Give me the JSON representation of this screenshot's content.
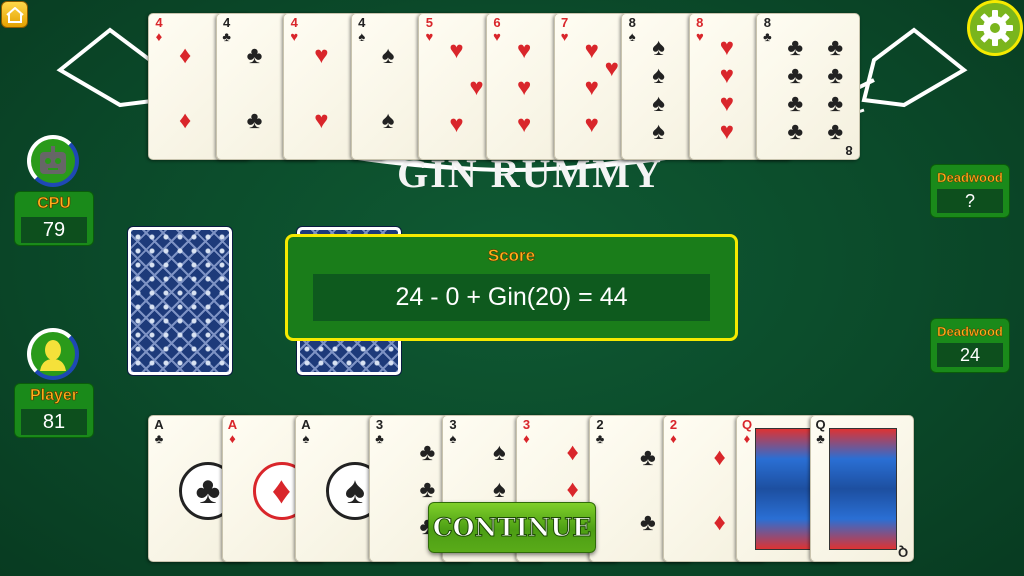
{
  "banner_text": "GIN RUMMY",
  "cpu": {
    "label": "CPU",
    "score": "79",
    "deadwood_label": "Deadwood",
    "deadwood": "?"
  },
  "player": {
    "label": "Player",
    "score": "81",
    "deadwood_label": "Deadwood",
    "deadwood": "24"
  },
  "score_dialog": {
    "title": "Score",
    "equation": "24 - 0 + Gin(20) = 44"
  },
  "continue_label": "CONTINUE",
  "icons": {
    "home": "home-icon",
    "settings": "gear-icon",
    "cpu_avatar": "robot-icon",
    "player_avatar": "person-icon"
  },
  "colors": {
    "felt": "#0b4a2a",
    "panel": "#1a8a1a",
    "label": "#ffb21a",
    "dialog_border": "#f5ea00",
    "red_suit": "#d9262b"
  },
  "cpu_hand": [
    {
      "rank": "4",
      "suit": "♦"
    },
    {
      "rank": "4",
      "suit": "♣"
    },
    {
      "rank": "4",
      "suit": "♥"
    },
    {
      "rank": "4",
      "suit": "♠"
    },
    {
      "rank": "5",
      "suit": "♥"
    },
    {
      "rank": "6",
      "suit": "♥"
    },
    {
      "rank": "7",
      "suit": "♥"
    },
    {
      "rank": "8",
      "suit": "♠"
    },
    {
      "rank": "8",
      "suit": "♥"
    },
    {
      "rank": "8",
      "suit": "♣"
    }
  ],
  "player_hand": [
    {
      "rank": "A",
      "suit": "♣"
    },
    {
      "rank": "A",
      "suit": "♦"
    },
    {
      "rank": "A",
      "suit": "♠"
    },
    {
      "rank": "3",
      "suit": "♣"
    },
    {
      "rank": "3",
      "suit": "♠"
    },
    {
      "rank": "3",
      "suit": "♦"
    },
    {
      "rank": "2",
      "suit": "♣"
    },
    {
      "rank": "2",
      "suit": "♦"
    },
    {
      "rank": "Q",
      "suit": "♦"
    },
    {
      "rank": "Q",
      "suit": "♣"
    }
  ]
}
